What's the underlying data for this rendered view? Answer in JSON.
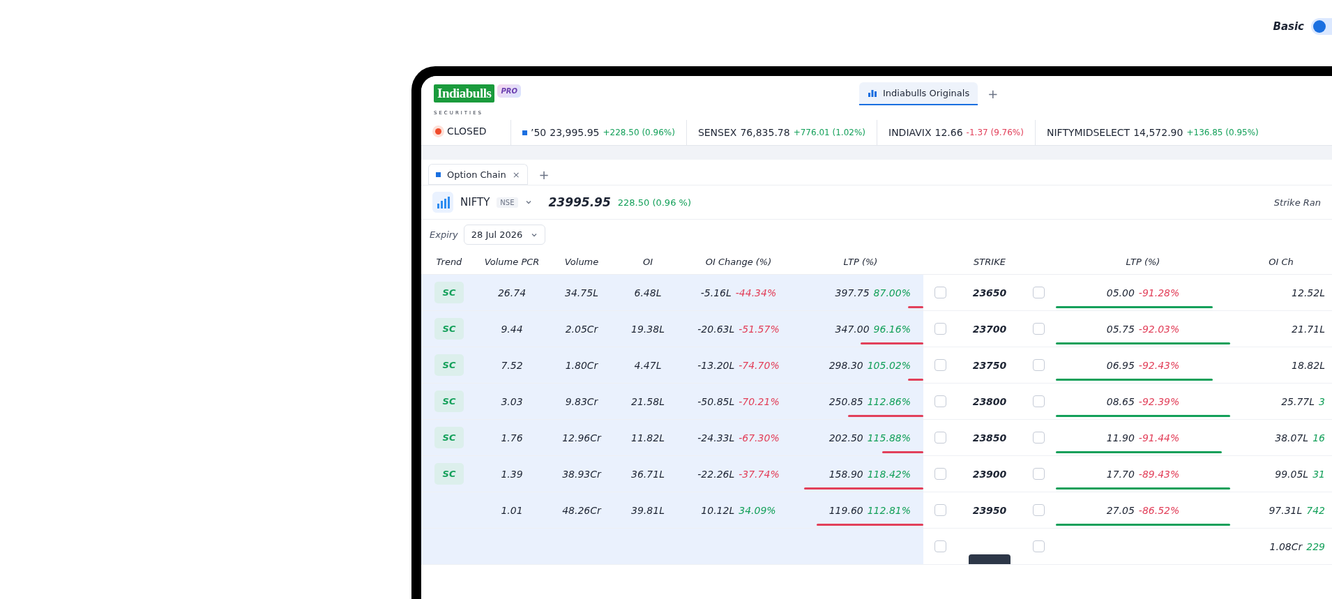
{
  "mode_switch": {
    "label": "Basic",
    "on": true
  },
  "app_tabs": [
    {
      "label": "Indiabulls Originals",
      "selected": true
    }
  ],
  "app_new_tab": "+",
  "logo": {
    "name": "Indiabulls",
    "subtitle": "SECURITIES",
    "badge": "PRO"
  },
  "market_status": "CLOSED",
  "tickers": [
    {
      "name": "’50",
      "value": "23,995.95",
      "change": "+228.50 (0.96%)",
      "up": true,
      "flagged": true
    },
    {
      "name": "SENSEX",
      "value": "76,835.78",
      "change": "+776.01 (1.02%)",
      "up": true,
      "flagged": false
    },
    {
      "name": "INDIAVIX",
      "value": "12.66",
      "change": "-1.37 (9.76%)",
      "up": false,
      "flagged": false
    },
    {
      "name": "NIFTYMIDSELECT",
      "value": "14,572.90",
      "change": "+136.85 (0.95%)",
      "up": true,
      "flagged": false
    }
  ],
  "panel_tabs": [
    {
      "label": "Option Chain",
      "selected": true,
      "close": "×"
    }
  ],
  "panel_new_tab": "+",
  "instrument": {
    "symbol": "NIFTY",
    "exchange": "NSE",
    "price": "23995.95",
    "change": "228.50 (0.96 %)",
    "up": true
  },
  "strike_range_label": "Strike Ran",
  "expiry": {
    "label": "Expiry",
    "value": "28 Jul 2026"
  },
  "columns": {
    "calls": [
      "Trend",
      "Volume PCR",
      "Volume",
      "OI",
      "OI Change (%)",
      "LTP (%)"
    ],
    "strike": "STRIKE",
    "puts": [
      "LTP (%)",
      "OI Ch"
    ]
  },
  "rows": [
    {
      "trend": "SC",
      "volume_pcr": "26.74",
      "volume": "34.75L",
      "oi": "6.48L",
      "oi_change": "-5.16L",
      "oi_change_pct": "-44.34%",
      "oi_change_up": false,
      "ltp": "397.75",
      "ltp_pct": "87.00%",
      "ltp_up": true,
      "call_bar": {
        "level": 0.12
      },
      "call_checked": false,
      "strike": "23650",
      "put_checked": false,
      "atm": false,
      "put_ltp": "05.00",
      "put_ltp_pct": "-91.28%",
      "put_ltp_up": false,
      "put_bar": {
        "level": 0.9
      },
      "put_oi": "12.52L"
    },
    {
      "trend": "SC",
      "volume_pcr": "9.44",
      "volume": "2.05Cr",
      "oi": "19.38L",
      "oi_change": "-20.63L",
      "oi_change_pct": "-51.57%",
      "oi_change_up": false,
      "ltp": "347.00",
      "ltp_pct": "96.16%",
      "ltp_up": true,
      "call_bar": {
        "level": 0.5
      },
      "call_checked": false,
      "strike": "23700",
      "put_checked": false,
      "atm": false,
      "put_ltp": "05.75",
      "put_ltp_pct": "-92.03%",
      "put_ltp_up": false,
      "put_bar": {
        "level": 1
      },
      "put_oi": "21.71L"
    },
    {
      "trend": "SC",
      "volume_pcr": "7.52",
      "volume": "1.80Cr",
      "oi": "4.47L",
      "oi_change": "-13.20L",
      "oi_change_pct": "-74.70%",
      "oi_change_up": false,
      "ltp": "298.30",
      "ltp_pct": "105.02%",
      "ltp_up": true,
      "call_bar": {
        "level": 0.12
      },
      "call_checked": false,
      "strike": "23750",
      "put_checked": false,
      "atm": false,
      "put_ltp": "06.95",
      "put_ltp_pct": "-92.43%",
      "put_ltp_up": false,
      "put_bar": {
        "level": 0.9
      },
      "put_oi": "18.82L"
    },
    {
      "trend": "SC",
      "volume_pcr": "3.03",
      "volume": "9.83Cr",
      "oi": "21.58L",
      "oi_change": "-50.85L",
      "oi_change_pct": "-70.21%",
      "oi_change_up": false,
      "ltp": "250.85",
      "ltp_pct": "112.86%",
      "ltp_up": true,
      "call_bar": {
        "level": 0.6
      },
      "call_checked": false,
      "strike": "23800",
      "put_checked": false,
      "atm": false,
      "put_ltp": "08.65",
      "put_ltp_pct": "-92.39%",
      "put_ltp_up": false,
      "put_bar": {
        "level": 1
      },
      "put_oi": "25.77L",
      "put_oi_change": "3"
    },
    {
      "trend": "SC",
      "volume_pcr": "1.76",
      "volume": "12.96Cr",
      "oi": "11.82L",
      "oi_change": "-24.33L",
      "oi_change_pct": "-67.30%",
      "oi_change_up": false,
      "ltp": "202.50",
      "ltp_pct": "115.88%",
      "ltp_up": true,
      "call_bar": {
        "level": 0.33
      },
      "call_checked": false,
      "strike": "23850",
      "put_checked": false,
      "atm": false,
      "put_ltp": "11.90",
      "put_ltp_pct": "-91.44%",
      "put_ltp_up": false,
      "put_bar": {
        "level": 0.95
      },
      "put_oi": "38.07L",
      "put_oi_change": "16"
    },
    {
      "trend": "SC",
      "volume_pcr": "1.39",
      "volume": "38.93Cr",
      "oi": "36.71L",
      "oi_change": "-22.26L",
      "oi_change_pct": "-37.74%",
      "oi_change_up": false,
      "ltp": "158.90",
      "ltp_pct": "118.42%",
      "ltp_up": true,
      "call_bar": {
        "level": 0.95
      },
      "call_checked": false,
      "strike": "23900",
      "put_checked": false,
      "atm": false,
      "put_ltp": "17.70",
      "put_ltp_pct": "-89.43%",
      "put_ltp_up": false,
      "put_bar": {
        "level": 1
      },
      "put_oi": "99.05L",
      "put_oi_change": "31"
    },
    {
      "volume_pcr": "1.01",
      "volume": "48.26Cr",
      "oi": "39.81L",
      "oi_change": "10.12L",
      "oi_change_pct": "34.09%",
      "oi_change_up": true,
      "ltp": "119.60",
      "ltp_pct": "112.81%",
      "ltp_up": true,
      "call_bar": {
        "level": 0.85
      },
      "call_checked": false,
      "strike": "23950",
      "put_checked": false,
      "atm": false,
      "put_ltp": "27.05",
      "put_ltp_pct": "-86.52%",
      "put_ltp_up": false,
      "put_bar": {
        "level": 1
      },
      "put_oi": "97.31L",
      "put_oi_change": "742"
    },
    {
      "call_checked": false,
      "put_checked": false,
      "atm": true,
      "put_oi": "1.08Cr",
      "put_oi_change": "229"
    }
  ]
}
